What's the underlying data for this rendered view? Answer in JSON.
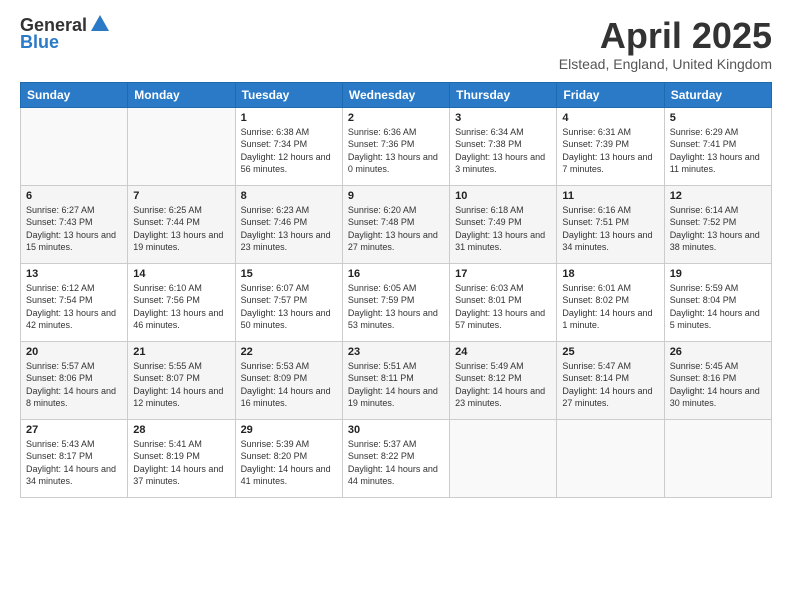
{
  "logo": {
    "general": "General",
    "blue": "Blue"
  },
  "title": {
    "month_year": "April 2025",
    "location": "Elstead, England, United Kingdom"
  },
  "weekdays": [
    "Sunday",
    "Monday",
    "Tuesday",
    "Wednesday",
    "Thursday",
    "Friday",
    "Saturday"
  ],
  "weeks": [
    [
      null,
      null,
      {
        "day": 1,
        "sunrise": "Sunrise: 6:38 AM",
        "sunset": "Sunset: 7:34 PM",
        "daylight": "Daylight: 12 hours and 56 minutes."
      },
      {
        "day": 2,
        "sunrise": "Sunrise: 6:36 AM",
        "sunset": "Sunset: 7:36 PM",
        "daylight": "Daylight: 13 hours and 0 minutes."
      },
      {
        "day": 3,
        "sunrise": "Sunrise: 6:34 AM",
        "sunset": "Sunset: 7:38 PM",
        "daylight": "Daylight: 13 hours and 3 minutes."
      },
      {
        "day": 4,
        "sunrise": "Sunrise: 6:31 AM",
        "sunset": "Sunset: 7:39 PM",
        "daylight": "Daylight: 13 hours and 7 minutes."
      },
      {
        "day": 5,
        "sunrise": "Sunrise: 6:29 AM",
        "sunset": "Sunset: 7:41 PM",
        "daylight": "Daylight: 13 hours and 11 minutes."
      }
    ],
    [
      {
        "day": 6,
        "sunrise": "Sunrise: 6:27 AM",
        "sunset": "Sunset: 7:43 PM",
        "daylight": "Daylight: 13 hours and 15 minutes."
      },
      {
        "day": 7,
        "sunrise": "Sunrise: 6:25 AM",
        "sunset": "Sunset: 7:44 PM",
        "daylight": "Daylight: 13 hours and 19 minutes."
      },
      {
        "day": 8,
        "sunrise": "Sunrise: 6:23 AM",
        "sunset": "Sunset: 7:46 PM",
        "daylight": "Daylight: 13 hours and 23 minutes."
      },
      {
        "day": 9,
        "sunrise": "Sunrise: 6:20 AM",
        "sunset": "Sunset: 7:48 PM",
        "daylight": "Daylight: 13 hours and 27 minutes."
      },
      {
        "day": 10,
        "sunrise": "Sunrise: 6:18 AM",
        "sunset": "Sunset: 7:49 PM",
        "daylight": "Daylight: 13 hours and 31 minutes."
      },
      {
        "day": 11,
        "sunrise": "Sunrise: 6:16 AM",
        "sunset": "Sunset: 7:51 PM",
        "daylight": "Daylight: 13 hours and 34 minutes."
      },
      {
        "day": 12,
        "sunrise": "Sunrise: 6:14 AM",
        "sunset": "Sunset: 7:52 PM",
        "daylight": "Daylight: 13 hours and 38 minutes."
      }
    ],
    [
      {
        "day": 13,
        "sunrise": "Sunrise: 6:12 AM",
        "sunset": "Sunset: 7:54 PM",
        "daylight": "Daylight: 13 hours and 42 minutes."
      },
      {
        "day": 14,
        "sunrise": "Sunrise: 6:10 AM",
        "sunset": "Sunset: 7:56 PM",
        "daylight": "Daylight: 13 hours and 46 minutes."
      },
      {
        "day": 15,
        "sunrise": "Sunrise: 6:07 AM",
        "sunset": "Sunset: 7:57 PM",
        "daylight": "Daylight: 13 hours and 50 minutes."
      },
      {
        "day": 16,
        "sunrise": "Sunrise: 6:05 AM",
        "sunset": "Sunset: 7:59 PM",
        "daylight": "Daylight: 13 hours and 53 minutes."
      },
      {
        "day": 17,
        "sunrise": "Sunrise: 6:03 AM",
        "sunset": "Sunset: 8:01 PM",
        "daylight": "Daylight: 13 hours and 57 minutes."
      },
      {
        "day": 18,
        "sunrise": "Sunrise: 6:01 AM",
        "sunset": "Sunset: 8:02 PM",
        "daylight": "Daylight: 14 hours and 1 minute."
      },
      {
        "day": 19,
        "sunrise": "Sunrise: 5:59 AM",
        "sunset": "Sunset: 8:04 PM",
        "daylight": "Daylight: 14 hours and 5 minutes."
      }
    ],
    [
      {
        "day": 20,
        "sunrise": "Sunrise: 5:57 AM",
        "sunset": "Sunset: 8:06 PM",
        "daylight": "Daylight: 14 hours and 8 minutes."
      },
      {
        "day": 21,
        "sunrise": "Sunrise: 5:55 AM",
        "sunset": "Sunset: 8:07 PM",
        "daylight": "Daylight: 14 hours and 12 minutes."
      },
      {
        "day": 22,
        "sunrise": "Sunrise: 5:53 AM",
        "sunset": "Sunset: 8:09 PM",
        "daylight": "Daylight: 14 hours and 16 minutes."
      },
      {
        "day": 23,
        "sunrise": "Sunrise: 5:51 AM",
        "sunset": "Sunset: 8:11 PM",
        "daylight": "Daylight: 14 hours and 19 minutes."
      },
      {
        "day": 24,
        "sunrise": "Sunrise: 5:49 AM",
        "sunset": "Sunset: 8:12 PM",
        "daylight": "Daylight: 14 hours and 23 minutes."
      },
      {
        "day": 25,
        "sunrise": "Sunrise: 5:47 AM",
        "sunset": "Sunset: 8:14 PM",
        "daylight": "Daylight: 14 hours and 27 minutes."
      },
      {
        "day": 26,
        "sunrise": "Sunrise: 5:45 AM",
        "sunset": "Sunset: 8:16 PM",
        "daylight": "Daylight: 14 hours and 30 minutes."
      }
    ],
    [
      {
        "day": 27,
        "sunrise": "Sunrise: 5:43 AM",
        "sunset": "Sunset: 8:17 PM",
        "daylight": "Daylight: 14 hours and 34 minutes."
      },
      {
        "day": 28,
        "sunrise": "Sunrise: 5:41 AM",
        "sunset": "Sunset: 8:19 PM",
        "daylight": "Daylight: 14 hours and 37 minutes."
      },
      {
        "day": 29,
        "sunrise": "Sunrise: 5:39 AM",
        "sunset": "Sunset: 8:20 PM",
        "daylight": "Daylight: 14 hours and 41 minutes."
      },
      {
        "day": 30,
        "sunrise": "Sunrise: 5:37 AM",
        "sunset": "Sunset: 8:22 PM",
        "daylight": "Daylight: 14 hours and 44 minutes."
      },
      null,
      null,
      null
    ]
  ]
}
